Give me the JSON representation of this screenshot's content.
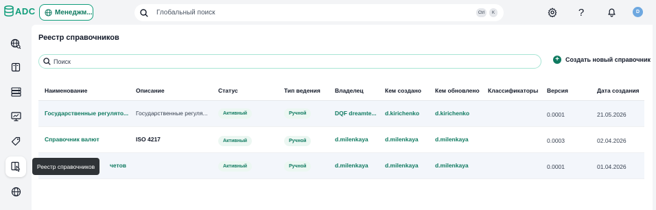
{
  "app": {
    "logo_text": "ADC",
    "workspace_label": "Менеджм...",
    "brand_color": "#0f9d7a"
  },
  "topbar": {
    "search_placeholder": "Глобальный поиск",
    "kbd_ctrl": "Ctrl",
    "kbd_k": "K",
    "avatar_initial": "D"
  },
  "page": {
    "title": "Реестр справочников",
    "search_placeholder": "Поиск",
    "create_label": "Создать новый справочник"
  },
  "table": {
    "headers": {
      "name": "Наименование",
      "description": "Описание",
      "status": "Статус",
      "type": "Тип ведения",
      "owner": "Владелец",
      "created_by": "Кем создано",
      "updated_by": "Кем обновлено",
      "classifiers": "Классификаторы",
      "version": "Версия",
      "created_at": "Дата создания"
    },
    "rows": [
      {
        "name": "Государственные регулято...",
        "description": "Государственные регуля...",
        "status": "Активный",
        "type": "Ручной",
        "owner": "DQF dreamte...",
        "created_by": "d.kirichenko",
        "updated_by": "d.kirichenko",
        "classifiers": "",
        "version": "0.0001",
        "created_at": "21.05.2026"
      },
      {
        "name": "Справочник валют",
        "description": "ISO 4217",
        "status": "Активный",
        "type": "Ручной",
        "owner": "d.milenkaya",
        "created_by": "d.milenkaya",
        "updated_by": "d.milenkaya",
        "classifiers": "",
        "version": "0.0003",
        "created_at": "02.04.2026"
      },
      {
        "name": "четов",
        "description": "",
        "status": "Активный",
        "type": "Ручной",
        "owner": "d.milenkaya",
        "created_by": "d.milenkaya",
        "updated_by": "d.milenkaya",
        "classifiers": "",
        "version": "0.0001",
        "created_at": "01.04.2026"
      }
    ]
  },
  "tooltip": {
    "text": "Реестр справочников"
  }
}
